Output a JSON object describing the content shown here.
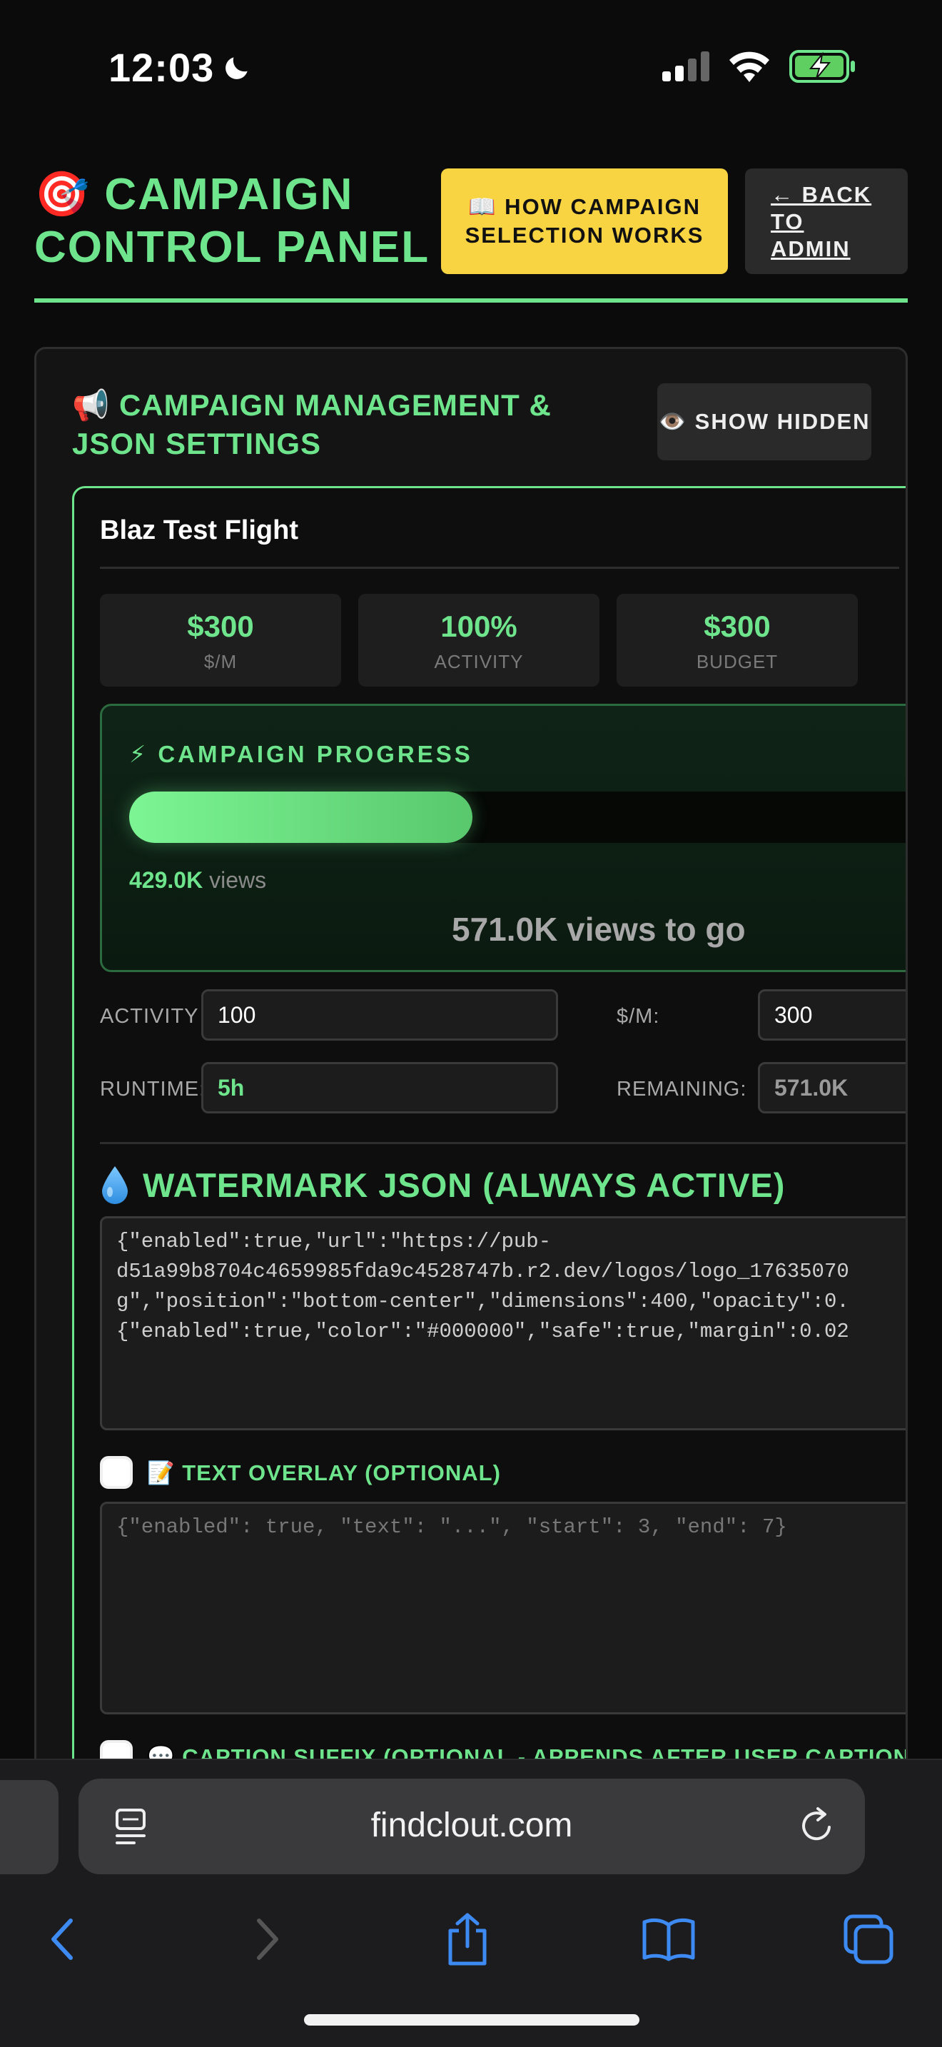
{
  "status_bar": {
    "time": "12:03"
  },
  "header": {
    "icon": "dart-target-icon",
    "title": "🎯 CAMPAIGN CONTROL PANEL",
    "how_button": "📖 HOW CAMPAIGN SELECTION WORKS",
    "back_button": "← BACK TO ADMIN"
  },
  "panel": {
    "title": "📢 CAMPAIGN MANAGEMENT & JSON SETTINGS",
    "show_hidden_button": "👁️ SHOW HIDDEN",
    "campaign": {
      "name": "Blaz Test Flight",
      "stats": [
        {
          "value": "$300",
          "label": "$/M"
        },
        {
          "value": "100%",
          "label": "ACTIVITY"
        },
        {
          "value": "$300",
          "label": "BUDGET"
        }
      ],
      "progress": {
        "title": "⚡ CAMPAIGN PROGRESS",
        "fraction": 0.429,
        "views_value": "429.0K",
        "views_unit": "views",
        "to_go": "571.0K views to go"
      },
      "fields": {
        "activity_label": "ACTIVITY %:",
        "activity_value": "100",
        "rate_label": "$/M:",
        "rate_value": "300",
        "runtime_label": "RUNTIME:",
        "runtime_value": "5h",
        "remaining_label": "REMAINING:",
        "remaining_value": "571.0K"
      },
      "watermark": {
        "title": "WATERMARK JSON (ALWAYS ACTIVE)",
        "json_line_1": "{\"enabled\":true,\"url\":\"https://pub-",
        "json_line_2": "d51a99b8704c4659985fda9c4528747b.r2.dev/logos/logo_17635070",
        "json_line_3": "g\",\"position\":\"bottom-center\",\"dimensions\":400,\"opacity\":0.",
        "json_line_4": "{\"enabled\":true,\"color\":\"#000000\",\"safe\":true,\"margin\":0.02"
      },
      "text_overlay": {
        "label": "📝 TEXT OVERLAY (OPTIONAL)",
        "placeholder": "{\"enabled\": true, \"text\": \"...\", \"start\": 3, \"end\": 7}"
      },
      "caption_suffix": {
        "label": "💬 CAPTION SUFFIX (OPTIONAL - APPENDS AFTER USER CAPTION)"
      }
    }
  },
  "browser": {
    "url": "findclout.com"
  },
  "colors": {
    "accent_green": "#6ee58c",
    "button_yellow": "#f8d443",
    "background": "#0b0b0b"
  }
}
